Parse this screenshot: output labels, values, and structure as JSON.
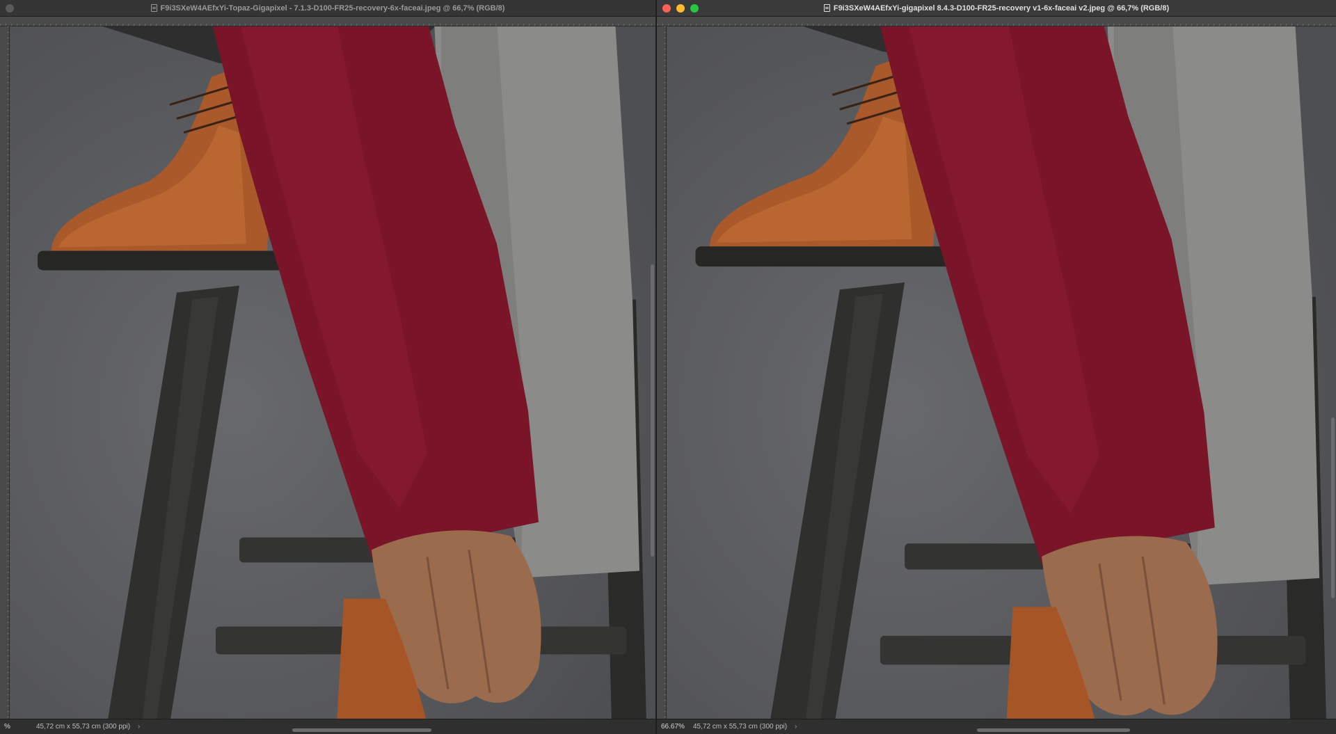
{
  "left_window": {
    "title": "F9i3SXeW4AEfxYi-Topaz-Gigapixel - 7.1.3-D100-FR25-recovery-6x-faceai.jpeg @ 66,7% (RGB/8)",
    "zoom": "%",
    "doc_size": "45,72 cm x 55,73 cm (300 ppi)",
    "status_arrow": "›",
    "active": false
  },
  "right_window": {
    "title": "F9i3SXeW4AEfxYi-gigapixel 8.4.3-D100-FR25-recovery v1-6x-faceai v2.jpeg @ 66,7% (RGB/8)",
    "zoom": "66.67%",
    "doc_size": "45,72 cm x 55,73 cm (300 ppi)",
    "status_arrow": "›",
    "active": true
  },
  "colors": {
    "backdrop": "#5f6063",
    "sweater": "#7a1428",
    "trousers": "#8d8d8b",
    "shoe": "#a9592a",
    "stool": "#2f302d",
    "skin": "#9b6b4e"
  },
  "icons": {
    "document": "doc-icon",
    "close": "close-light",
    "minimize": "minimize-light",
    "zoom": "zoom-light"
  }
}
